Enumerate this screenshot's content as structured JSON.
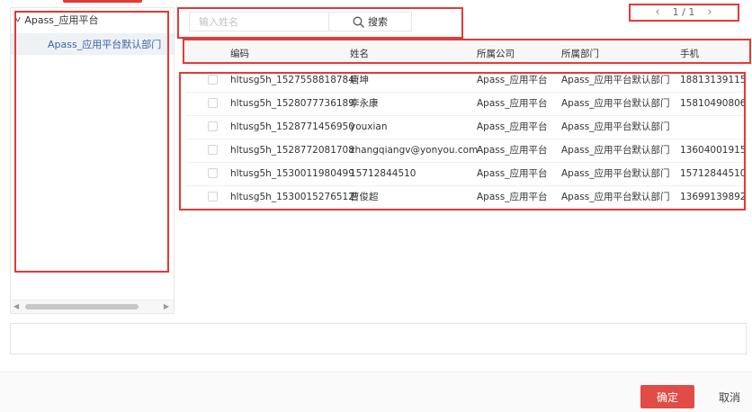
{
  "tree": {
    "root_label": "Apass_应用平台",
    "child_label": "Apass_应用平台默认部门"
  },
  "search": {
    "placeholder": "输入姓名",
    "button_label": "搜索"
  },
  "pager": {
    "prev": "‹",
    "text": "1 / 1",
    "next": "›"
  },
  "table": {
    "headers": {
      "code": "编码",
      "name": "姓名",
      "company": "所属公司",
      "dept": "所属部门",
      "phone": "手机"
    },
    "rows": [
      {
        "code": "hltusg5h_1527558818784",
        "name": "唐坤",
        "company": "Apass_应用平台",
        "dept": "Apass_应用平台默认部门",
        "phone": "18813139115"
      },
      {
        "code": "hltusg5h_1528077736189",
        "name": "李永康",
        "company": "Apass_应用平台",
        "dept": "Apass_应用平台默认部门",
        "phone": "15810490806"
      },
      {
        "code": "hltusg5h_1528771456950",
        "name": "youxian",
        "company": "Apass_应用平台",
        "dept": "Apass_应用平台默认部门",
        "phone": ""
      },
      {
        "code": "hltusg5h_1528772081708",
        "name": "zhangqiangv@yonyou.com",
        "company": "Apass_应用平台",
        "dept": "Apass_应用平台默认部门",
        "phone": "13604001915"
      },
      {
        "code": "hltusg5h_1530011980499",
        "name": "15712844510",
        "company": "Apass_应用平台",
        "dept": "Apass_应用平台默认部门",
        "phone": "15712844510"
      },
      {
        "code": "hltusg5h_1530015276512",
        "name": "曹俊超",
        "company": "Apass_应用平台",
        "dept": "Apass_应用平台默认部门",
        "phone": "13699139892"
      }
    ]
  },
  "footer": {
    "ok_label": "确定",
    "cancel_label": "取消"
  },
  "colors": {
    "accent": "#e14c46",
    "annotation": "#e53935",
    "tree_selected_text": "#3d64a8"
  }
}
